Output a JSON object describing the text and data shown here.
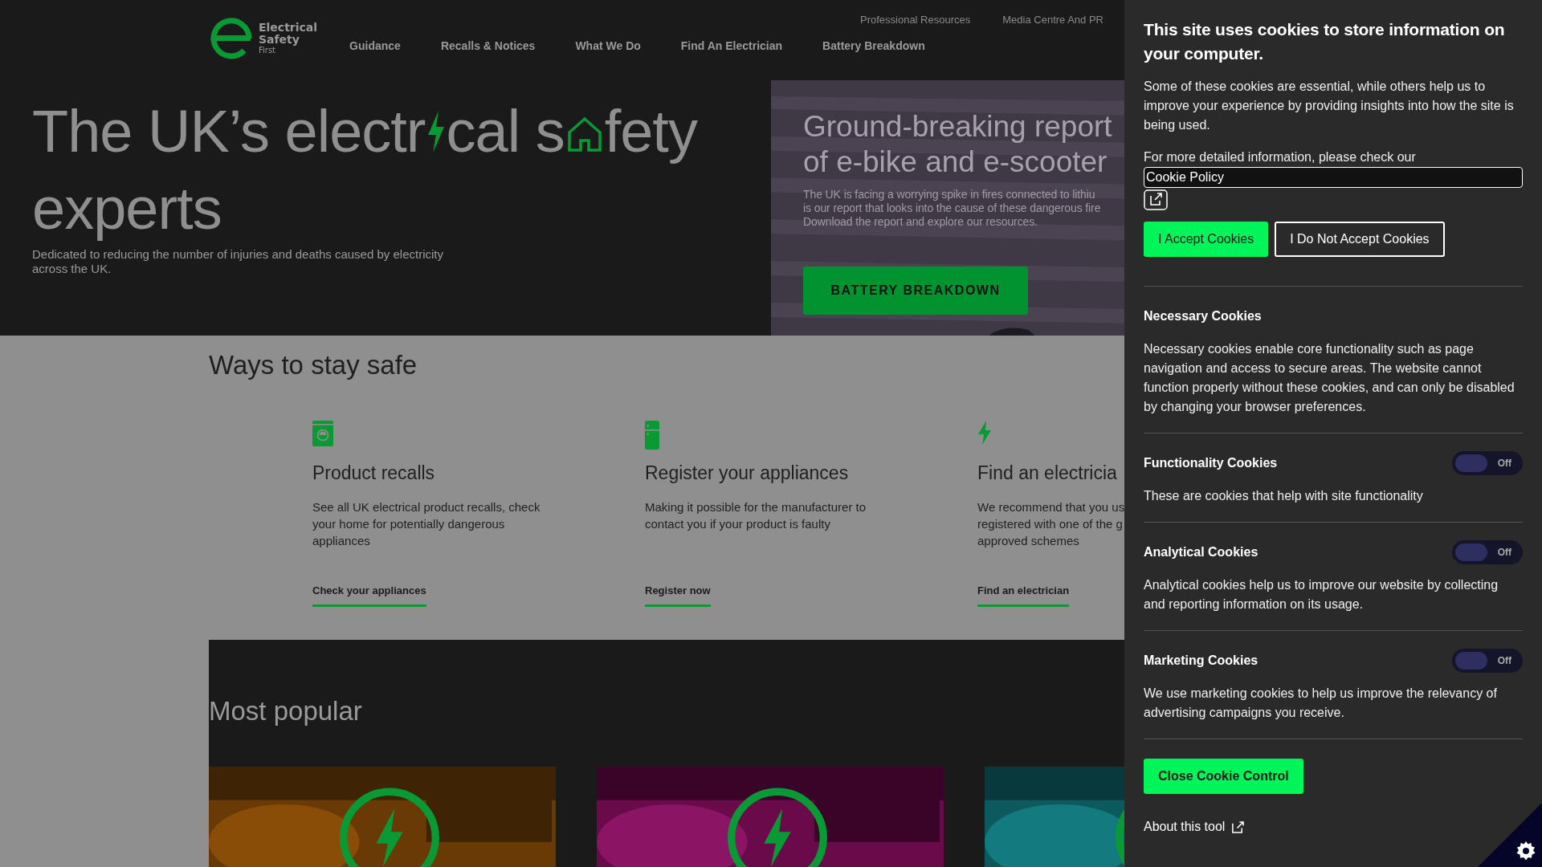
{
  "header": {
    "logo": {
      "lines": [
        "Electrical",
        "Safety",
        "First"
      ]
    },
    "top_links": [
      "Professional Resources",
      "Media Centre And PR"
    ],
    "nav": [
      "Guidance",
      "Recalls & Notices",
      "What We Do",
      "Find An Electrician",
      "Battery Breakdown"
    ]
  },
  "hero": {
    "title_lines": [
      [
        {
          "kind": "text",
          "text": "The UK’s electr"
        },
        {
          "kind": "bolt"
        },
        {
          "kind": "text",
          "text": "cal s"
        },
        {
          "kind": "house"
        },
        {
          "kind": "text",
          "text": "fety"
        }
      ],
      [
        {
          "kind": "text",
          "text": "experts"
        }
      ]
    ],
    "subtitle": "Dedicated to reducing the number of injuries and deaths caused by electricity across the UK.",
    "promo": {
      "kind": "picture",
      "heading_lines": [
        "Ground-breaking report",
        "of e-bike and e-scooter"
      ],
      "body_lines": [
        "The UK is facing a worrying spike in fires connected to lithiu",
        "is our report that looks into the cause of these dangerous fire",
        "Download the report and explore our resources."
      ],
      "button": "BATTERY BREAKDOWN"
    }
  },
  "ways": {
    "heading": "Ways to stay safe",
    "cards": [
      {
        "kind": "washer",
        "title": "Product recalls",
        "description_lines": [
          "See all UK electrical product recalls, check",
          "your home for potentially dangerous",
          "appliances"
        ],
        "link": "Check your appliances"
      },
      {
        "kind": "fridge",
        "title": "Register your appliances",
        "description_lines": [
          "Making it possible for the manufacturer to",
          "contact you if your product is faulty"
        ],
        "link": "Register now"
      },
      {
        "kind": "bolt",
        "title": "Find an electricia",
        "description_lines": [
          "We recommend that you us",
          "registered with one of the g",
          "approved schemes"
        ],
        "link": "Find an electrician"
      }
    ]
  },
  "popular": {
    "heading": "Most popular"
  },
  "cookie_panel": {
    "title": "This site uses cookies to store information on your computer.",
    "intro": "Some of these cookies are essential, while others help us to improve your experience by providing insights into how the site is being used.",
    "policy_text": "For more detailed information, please check our",
    "policy_link": "Cookie Policy",
    "accept_button": "I Accept Cookies",
    "reject_button": "I Do Not Accept Cookies",
    "sections": [
      {
        "kind": "fixed",
        "title": "Necessary Cookies",
        "description": "Necessary cookies enable core functionality such as page navigation and access to secure areas. The website cannot function properly without these cookies, and can only be disabled by changing your browser preferences."
      },
      {
        "kind": "toggle",
        "title": "Functionality Cookies",
        "toggle_label": "Off",
        "on": false,
        "description": "These are cookies that help with site functionality"
      },
      {
        "kind": "toggle",
        "title": "Analytical Cookies",
        "toggle_label": "Off",
        "on": false,
        "description": "Analytical cookies help us to improve our website by collecting and reporting information on its usage."
      },
      {
        "kind": "toggle",
        "title": "Marketing Cookies",
        "toggle_label": "Off",
        "on": false,
        "description": "We use marketing cookies to help us improve the relevancy of advertising campaigns you receive."
      }
    ],
    "close_button": "Close Cookie Control",
    "about_link": "About this tool"
  }
}
